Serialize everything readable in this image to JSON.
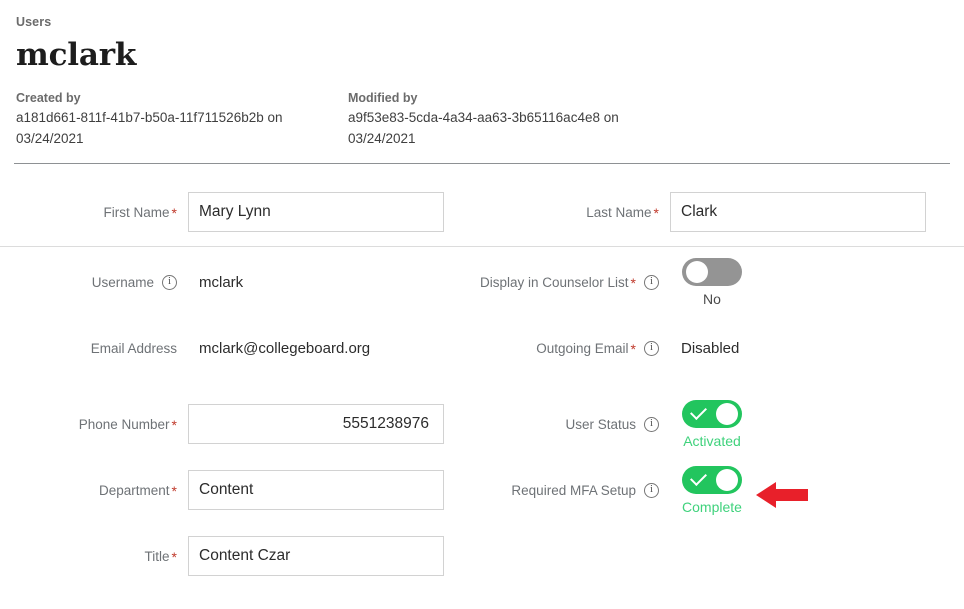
{
  "header": {
    "breadcrumb": "Users",
    "title": "mclark",
    "created": {
      "label": "Created by",
      "value": "a181d661-811f-41b7-b50a-11f711526b2b on 03/24/2021"
    },
    "modified": {
      "label": "Modified by",
      "value": "a9f53e83-5cda-4a34-aa63-3b65116ac4e8 on 03/24/2021"
    }
  },
  "form": {
    "first_name": {
      "label": "First Name",
      "required": "*",
      "value": "Mary Lynn"
    },
    "last_name": {
      "label": "Last Name",
      "required": "*",
      "value": "Clark"
    },
    "username": {
      "label": "Username",
      "value": "mclark",
      "info": "info-icon"
    },
    "email": {
      "label": "Email Address",
      "value": "mclark@collegeboard.org"
    },
    "phone": {
      "label": "Phone Number",
      "required": "*",
      "value": "5551238976"
    },
    "department": {
      "label": "Department",
      "required": "*",
      "value": "Content"
    },
    "title": {
      "label": "Title",
      "required": "*",
      "value": "Content Czar"
    },
    "counselor_list": {
      "label": "Display in Counselor List",
      "required": "*",
      "info": "info-icon",
      "state": "off",
      "status": "No"
    },
    "outgoing_email": {
      "label": "Outgoing Email",
      "required": "*",
      "info": "info-icon",
      "value": "Disabled"
    },
    "user_status": {
      "label": "User Status",
      "info": "info-icon",
      "state": "on",
      "status": "Activated"
    },
    "mfa_setup": {
      "label": "Required MFA Setup",
      "info": "info-icon",
      "state": "on",
      "status": "Complete"
    }
  },
  "annotation": {
    "arrow": "left-arrow-annotation",
    "color": "#e8202a"
  },
  "colors": {
    "toggle_on": "#22c55e",
    "toggle_off": "#949494",
    "status_green": "#3fd27c",
    "required_asterisk": "#c0392b",
    "divider_strong": "#8e9194",
    "divider_light": "#dcdcdc"
  },
  "icons": {
    "info": "i"
  }
}
